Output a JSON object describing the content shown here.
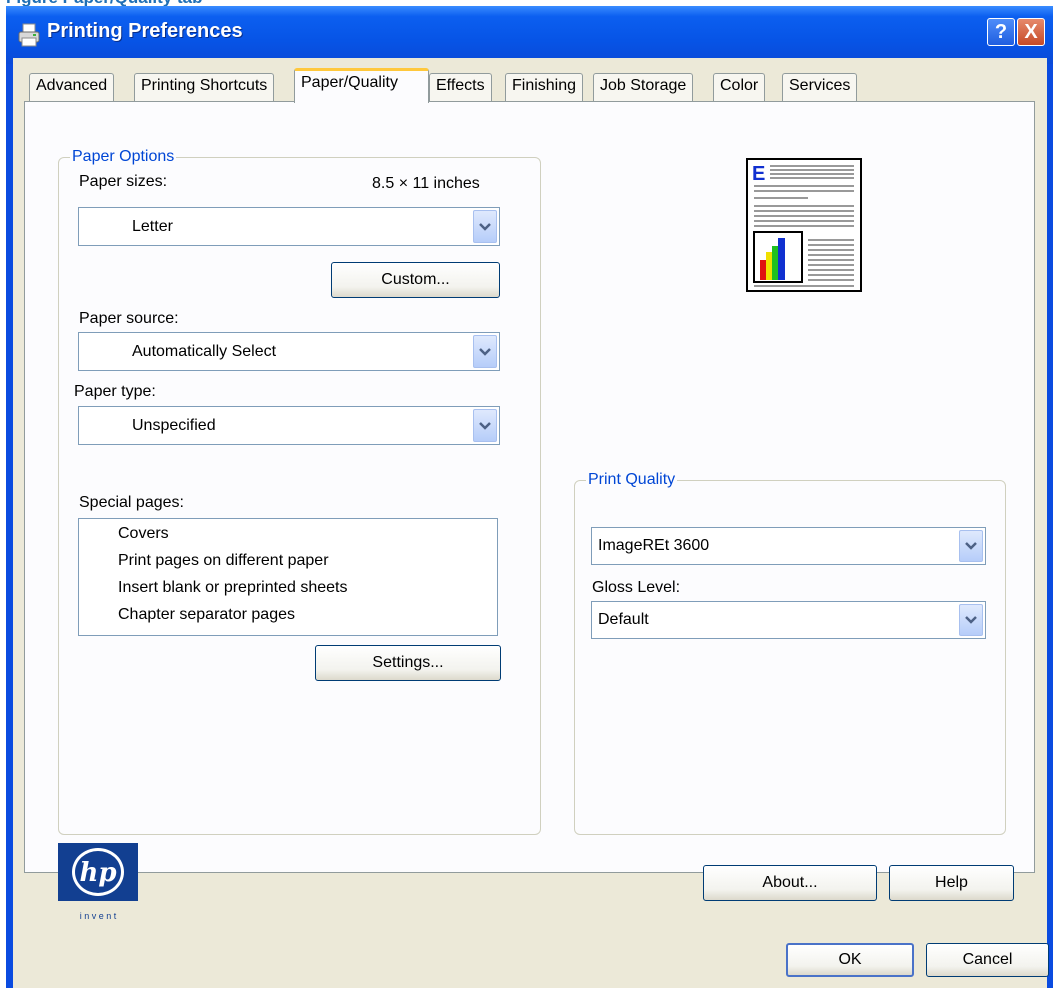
{
  "figure_caption": "Figure Paper/Quality tab",
  "window": {
    "title": "Printing Preferences",
    "help_button": "?",
    "close_button": "X"
  },
  "tabs": [
    {
      "label": "Advanced"
    },
    {
      "label": "Printing Shortcuts"
    },
    {
      "label": "Paper/Quality",
      "active": true
    },
    {
      "label": "Effects"
    },
    {
      "label": "Finishing"
    },
    {
      "label": "Job Storage"
    },
    {
      "label": "Color"
    },
    {
      "label": "Services"
    }
  ],
  "paper_options": {
    "legend": "Paper Options",
    "paper_sizes_label": "Paper sizes:",
    "paper_size_dims": "8.5 × 11 inches",
    "paper_size_value": "Letter",
    "custom_button": "Custom...",
    "paper_source_label": "Paper source:",
    "paper_source_value": "Automatically Select",
    "paper_type_label": "Paper type:",
    "paper_type_value": "Unspecified",
    "special_pages_label": "Special pages:",
    "special_pages": [
      "Covers",
      "Print pages on different paper",
      "Insert blank or preprinted sheets",
      "Chapter separator pages"
    ],
    "settings_button": "Settings..."
  },
  "preview": {
    "letter": "E"
  },
  "print_quality": {
    "legend": "Print Quality",
    "quality_value": "ImageREt 3600",
    "gloss_label": "Gloss Level:",
    "gloss_value": "Default"
  },
  "logo": {
    "mark": "hp",
    "tagline": "i n v e n t"
  },
  "buttons": {
    "about": "About...",
    "help": "Help",
    "ok": "OK",
    "cancel": "Cancel"
  },
  "colors": {
    "title_bar": "#0754e6",
    "dialog_bg": "#ece9d8",
    "legend_text": "#0046d5",
    "active_tab_highlight": "#ffc83c"
  }
}
